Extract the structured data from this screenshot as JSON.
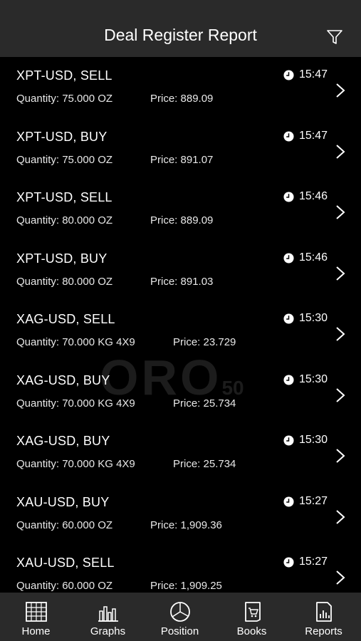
{
  "header": {
    "title": "Deal Register Report",
    "filter_icon": "filter-icon"
  },
  "watermark": {
    "text": "ORO",
    "sub": "50"
  },
  "deals": [
    {
      "symbol": "XPT-USD,  SELL",
      "time": "15:47",
      "quantity": "Quantity: 75.000 OZ",
      "price": "Price: 889.09"
    },
    {
      "symbol": "XPT-USD,  BUY",
      "time": "15:47",
      "quantity": "Quantity: 75.000 OZ",
      "price": "Price: 891.07"
    },
    {
      "symbol": "XPT-USD,  SELL",
      "time": "15:46",
      "quantity": "Quantity: 80.000 OZ",
      "price": "Price: 889.09"
    },
    {
      "symbol": "XPT-USD,  BUY",
      "time": "15:46",
      "quantity": "Quantity: 80.000 OZ",
      "price": "Price: 891.03"
    },
    {
      "symbol": "XAG-USD,  SELL",
      "time": "15:30",
      "quantity": "Quantity: 70.000 KG 4X9",
      "price": "Price: 23.729"
    },
    {
      "symbol": "XAG-USD,  BUY",
      "time": "15:30",
      "quantity": "Quantity: 70.000 KG 4X9",
      "price": "Price: 25.734"
    },
    {
      "symbol": "XAG-USD,  BUY",
      "time": "15:30",
      "quantity": "Quantity: 70.000 KG 4X9",
      "price": "Price: 25.734"
    },
    {
      "symbol": "XAU-USD,  BUY",
      "time": "15:27",
      "quantity": "Quantity: 60.000 OZ",
      "price": "Price: 1,909.36"
    },
    {
      "symbol": "XAU-USD,  SELL",
      "time": "15:27",
      "quantity": "Quantity: 60.000 OZ",
      "price": "Price: 1,909.25"
    }
  ],
  "tabs": [
    {
      "label": "Home",
      "icon": "home-grid-icon"
    },
    {
      "label": "Graphs",
      "icon": "bar-graph-icon"
    },
    {
      "label": "Position",
      "icon": "pie-chart-icon"
    },
    {
      "label": "Books",
      "icon": "cart-book-icon"
    },
    {
      "label": "Reports",
      "icon": "report-document-icon"
    }
  ]
}
